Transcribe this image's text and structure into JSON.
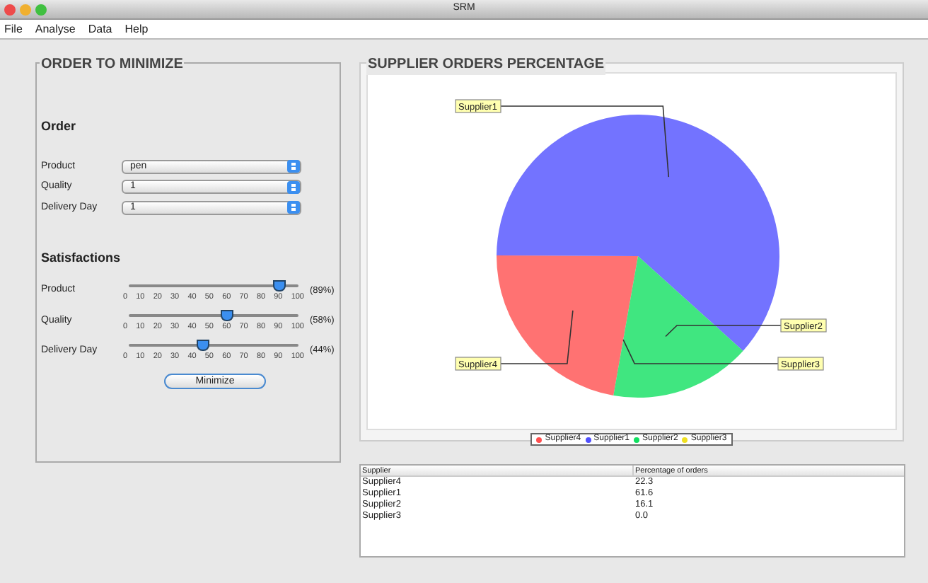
{
  "window": {
    "title": "SRM"
  },
  "menu": [
    "File",
    "Analyse",
    "Data",
    "Help"
  ],
  "order_panel": {
    "title": "ORDER TO MINIMIZE",
    "order_heading": "Order",
    "fields": [
      {
        "label": "Product",
        "value": "pen"
      },
      {
        "label": "Quality",
        "value": "1"
      },
      {
        "label": "Delivery Day",
        "value": "1"
      }
    ],
    "satisfactions_heading": "Satisfactions",
    "sliders": [
      {
        "label": "Product",
        "level": 0.89,
        "reading": "(89%)",
        "tick_labels": [
          "0",
          "10",
          "20",
          "30",
          "40",
          "50",
          "60",
          "70",
          "80",
          "90",
          "100"
        ]
      },
      {
        "label": "Quality",
        "level": 0.58,
        "reading": "(58%)",
        "tick_labels": [
          "0",
          "10",
          "20",
          "30",
          "40",
          "50",
          "60",
          "70",
          "80",
          "90",
          "100"
        ]
      },
      {
        "label": "Delivery Day",
        "level": 0.44,
        "reading": "(44%)",
        "tick_labels": [
          "0",
          "10",
          "20",
          "30",
          "40",
          "50",
          "60",
          "70",
          "80",
          "90",
          "100"
        ]
      }
    ],
    "button": "Minimize"
  },
  "chart_panel": {
    "title": "SUPPLIER ORDERS PERCENTAGE",
    "chart_data": {
      "type": "pie",
      "categories": [
        "Supplier4",
        "Supplier1",
        "Supplier2",
        "Supplier3"
      ],
      "values": [
        22.3,
        61.6,
        16.1,
        0.0
      ]
    },
    "legend": [
      {
        "label": "Supplier4",
        "color": "#ff4f4f"
      },
      {
        "label": "Supplier1",
        "color": "#5050ff"
      },
      {
        "label": "Supplier2",
        "color": "#10e060"
      },
      {
        "label": "Supplier3",
        "color": "#f0e020"
      }
    ]
  },
  "table": {
    "columns": [
      "Supplier",
      "Percentage of orders"
    ],
    "rows": [
      [
        "Supplier4",
        "22.3"
      ],
      [
        "Supplier1",
        "61.6"
      ],
      [
        "Supplier2",
        "16.1"
      ],
      [
        "Supplier3",
        "0.0"
      ]
    ]
  }
}
